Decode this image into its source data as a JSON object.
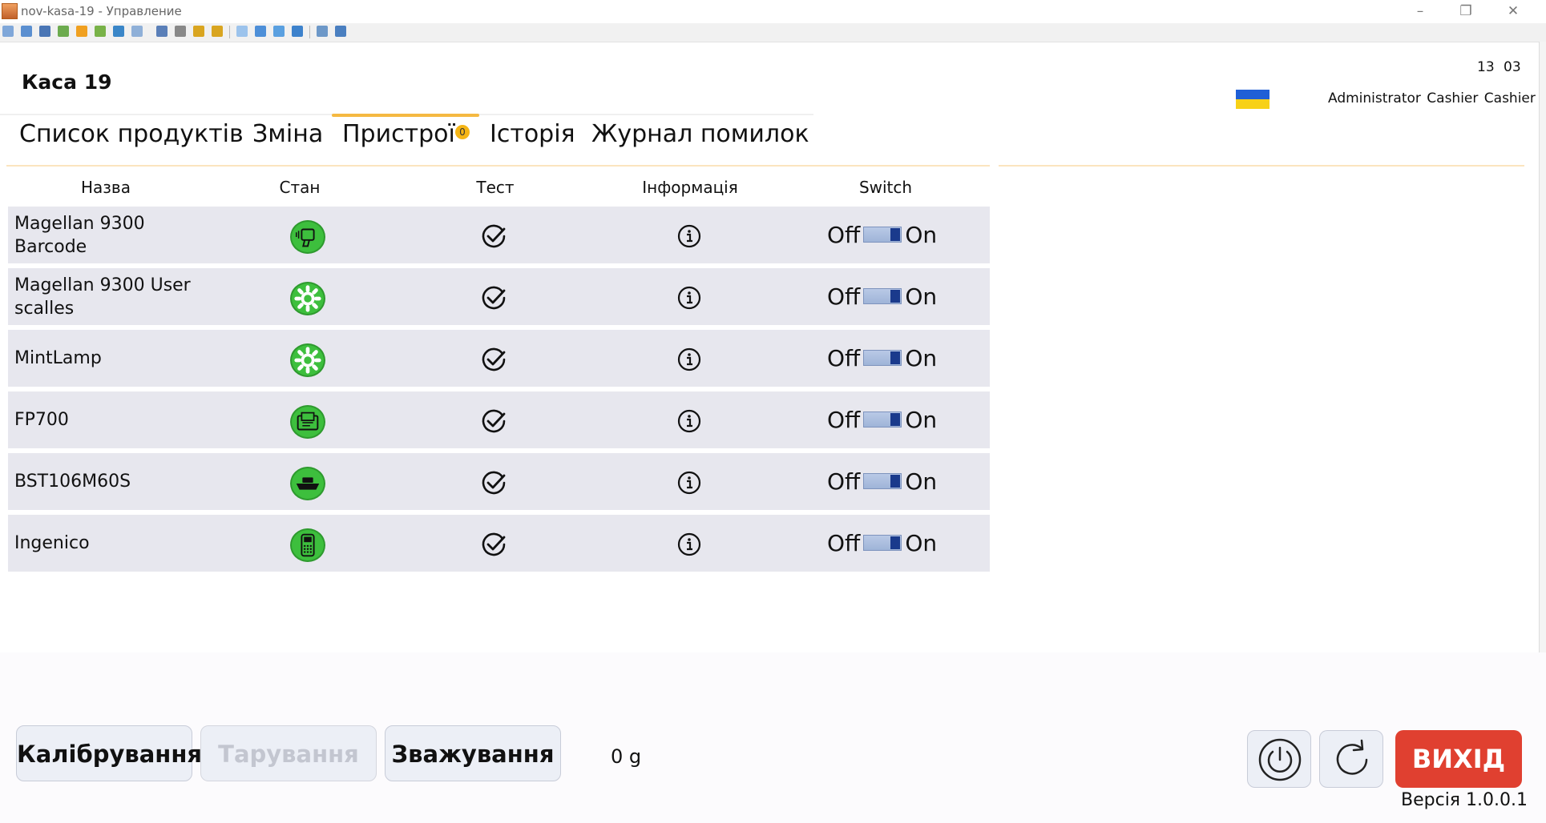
{
  "window": {
    "title": "nov-kasa-19 - Управление",
    "controls": [
      "minimize-icon",
      "restore-icon",
      "close-icon"
    ]
  },
  "toolbar": {
    "icons": [
      "screen-icon",
      "monitor-icon",
      "terminal-icon",
      "transfer-icon",
      "lock-icon",
      "users-icon",
      "phone-icon",
      "chat-icon",
      "person-icon",
      "people-icon",
      "folder-lock-icon",
      "folder-lock-icon",
      "window-icon",
      "fit-screen-icon",
      "fullscreen-icon",
      "scale-icon",
      "copy-icon",
      "tools-icon"
    ]
  },
  "header": {
    "title": "Каса 19",
    "time": "13 03",
    "user": "Administrator  Cashier Cashier",
    "flag_colors": [
      "#1f5fd6",
      "#f7d117"
    ]
  },
  "tabs": [
    {
      "label": "Список продуктів",
      "active": false
    },
    {
      "label": "Зміна",
      "active": false
    },
    {
      "label": "Пристрої",
      "active": true,
      "badge": "0"
    },
    {
      "label": "Історія",
      "active": false
    },
    {
      "label": "Журнал помилок",
      "active": false
    }
  ],
  "devices_table": {
    "headers": [
      "Назва",
      "Стан",
      "Тест",
      "Інформація",
      "Switch"
    ],
    "rows": [
      {
        "name": "Magellan 9300 Barcode",
        "status_icon": "barcode-scanner-icon",
        "switch_off": "Off",
        "switch_on": "On",
        "switch_state": "on"
      },
      {
        "name": "Magellan 9300 User scalles",
        "status_icon": "gear-icon",
        "switch_off": "Off",
        "switch_on": "On",
        "switch_state": "on"
      },
      {
        "name": "MintLamp",
        "status_icon": "gear-icon",
        "switch_off": "Off",
        "switch_on": "On",
        "switch_state": "on"
      },
      {
        "name": "FP700",
        "status_icon": "fiscal-printer-icon",
        "switch_off": "Off",
        "switch_on": "On",
        "switch_state": "on"
      },
      {
        "name": "BST106M60S",
        "status_icon": "scale-icon",
        "switch_off": "Off",
        "switch_on": "On",
        "switch_state": "on"
      },
      {
        "name": "Ingenico",
        "status_icon": "payment-terminal-icon",
        "switch_off": "Off",
        "switch_on": "On",
        "switch_state": "on"
      }
    ]
  },
  "bottom": {
    "calibrate_label": "Калібрування",
    "tare_label": "Тарування",
    "weigh_label": "Зважування",
    "weight_value": "0 g",
    "exit_label": "ВИХІД",
    "version": "Версія 1.0.0.1"
  },
  "colors": {
    "accent": "#f5b942",
    "status_ok": "#3dbf3d",
    "exit": "#e04030",
    "row_bg": "#e7e7ee"
  }
}
